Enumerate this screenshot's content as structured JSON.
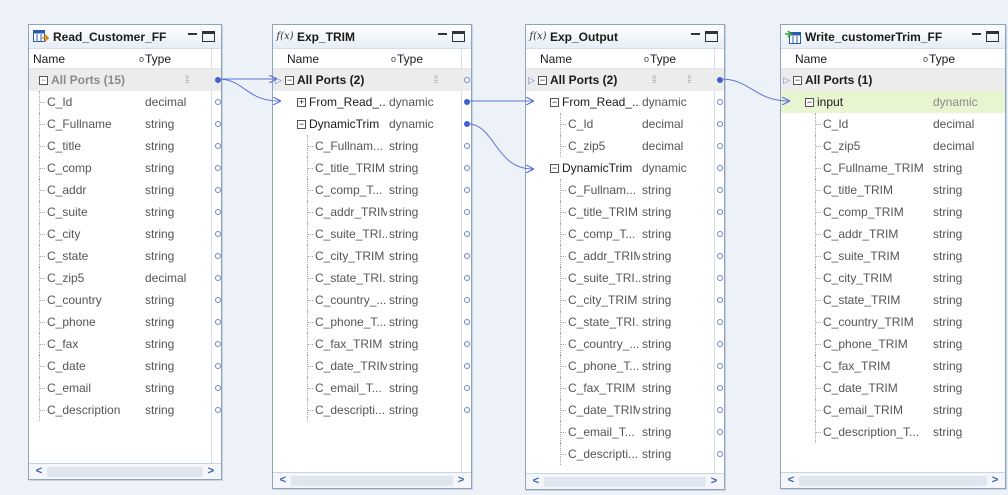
{
  "colors": {
    "link": "#5a73d6",
    "selected_row": "#e7f5d0",
    "all_ports_row": "#ececec"
  },
  "column_headers": {
    "name": "Name",
    "type": "Type"
  },
  "panels": [
    {
      "id": "read",
      "title": "Read_Customer_FF",
      "icon": "source-icon",
      "rows": [
        {
          "name": "All Ports (15)",
          "type": "",
          "kind": "allports",
          "expander": "minus",
          "disabled": true
        },
        {
          "name": "C_Id",
          "type": "decimal",
          "kind": "child"
        },
        {
          "name": "C_Fullname",
          "type": "string",
          "kind": "child"
        },
        {
          "name": "C_title",
          "type": "string",
          "kind": "child"
        },
        {
          "name": "C_comp",
          "type": "string",
          "kind": "child"
        },
        {
          "name": "C_addr",
          "type": "string",
          "kind": "child"
        },
        {
          "name": "C_suite",
          "type": "string",
          "kind": "child"
        },
        {
          "name": "C_city",
          "type": "string",
          "kind": "child"
        },
        {
          "name": "C_state",
          "type": "string",
          "kind": "child"
        },
        {
          "name": "C_zip5",
          "type": "decimal",
          "kind": "child"
        },
        {
          "name": "C_country",
          "type": "string",
          "kind": "child"
        },
        {
          "name": "C_phone",
          "type": "string",
          "kind": "child"
        },
        {
          "name": "C_fax",
          "type": "string",
          "kind": "child"
        },
        {
          "name": "C_date",
          "type": "string",
          "kind": "child"
        },
        {
          "name": "C_email",
          "type": "string",
          "kind": "child"
        },
        {
          "name": "C_description",
          "type": "string",
          "kind": "child"
        }
      ]
    },
    {
      "id": "trim",
      "title": "Exp_TRIM",
      "icon": "fx-icon",
      "rows": [
        {
          "name": "All Ports (2)",
          "type": "",
          "kind": "allports",
          "expander": "minus"
        },
        {
          "name": "From_Read_...",
          "type": "dynamic",
          "kind": "group",
          "expander": "plus"
        },
        {
          "name": "DynamicTrim",
          "type": "dynamic",
          "kind": "group",
          "expander": "minus"
        },
        {
          "name": "C_Fullnam...",
          "type": "string",
          "kind": "child"
        },
        {
          "name": "C_title_TRIM",
          "type": "string",
          "kind": "child"
        },
        {
          "name": "C_comp_T...",
          "type": "string",
          "kind": "child"
        },
        {
          "name": "C_addr_TRIM",
          "type": "string",
          "kind": "child"
        },
        {
          "name": "C_suite_TRI...",
          "type": "string",
          "kind": "child"
        },
        {
          "name": "C_city_TRIM",
          "type": "string",
          "kind": "child"
        },
        {
          "name": "C_state_TRI...",
          "type": "string",
          "kind": "child"
        },
        {
          "name": "C_country_...",
          "type": "string",
          "kind": "child"
        },
        {
          "name": "C_phone_T...",
          "type": "string",
          "kind": "child"
        },
        {
          "name": "C_fax_TRIM",
          "type": "string",
          "kind": "child"
        },
        {
          "name": "C_date_TRIM",
          "type": "string",
          "kind": "child"
        },
        {
          "name": "C_email_T...",
          "type": "string",
          "kind": "child"
        },
        {
          "name": "C_descripti...",
          "type": "string",
          "kind": "child"
        }
      ]
    },
    {
      "id": "output",
      "title": "Exp_Output",
      "icon": "fx-icon",
      "rows": [
        {
          "name": "All Ports (2)",
          "type": "",
          "kind": "allports",
          "expander": "minus"
        },
        {
          "name": "From_Read_...",
          "type": "dynamic",
          "kind": "group",
          "expander": "minus"
        },
        {
          "name": "C_Id",
          "type": "decimal",
          "kind": "child"
        },
        {
          "name": "C_zip5",
          "type": "decimal",
          "kind": "child"
        },
        {
          "name": "DynamicTrim",
          "type": "dynamic",
          "kind": "group",
          "expander": "minus"
        },
        {
          "name": "C_Fullnam...",
          "type": "string",
          "kind": "child"
        },
        {
          "name": "C_title_TRIM",
          "type": "string",
          "kind": "child"
        },
        {
          "name": "C_comp_T...",
          "type": "string",
          "kind": "child"
        },
        {
          "name": "C_addr_TRIM",
          "type": "string",
          "kind": "child"
        },
        {
          "name": "C_suite_TRI...",
          "type": "string",
          "kind": "child"
        },
        {
          "name": "C_city_TRIM",
          "type": "string",
          "kind": "child"
        },
        {
          "name": "C_state_TRI...",
          "type": "string",
          "kind": "child"
        },
        {
          "name": "C_country_...",
          "type": "string",
          "kind": "child"
        },
        {
          "name": "C_phone_T...",
          "type": "string",
          "kind": "child"
        },
        {
          "name": "C_fax_TRIM",
          "type": "string",
          "kind": "child"
        },
        {
          "name": "C_date_TRIM",
          "type": "string",
          "kind": "child"
        },
        {
          "name": "C_email_T...",
          "type": "string",
          "kind": "child"
        },
        {
          "name": "C_descripti...",
          "type": "string",
          "kind": "child"
        }
      ]
    },
    {
      "id": "write",
      "title": "Write_customerTrim_FF",
      "icon": "target-icon",
      "rows": [
        {
          "name": "All Ports (1)",
          "type": "",
          "kind": "allports",
          "expander": "minus"
        },
        {
          "name": "input",
          "type": "dynamic",
          "kind": "group",
          "expander": "minus",
          "selected": true
        },
        {
          "name": "C_Id",
          "type": "decimal",
          "kind": "child"
        },
        {
          "name": "C_zip5",
          "type": "decimal",
          "kind": "child"
        },
        {
          "name": "C_Fullname_TRIM",
          "type": "string",
          "kind": "child"
        },
        {
          "name": "C_title_TRIM",
          "type": "string",
          "kind": "child"
        },
        {
          "name": "C_comp_TRIM",
          "type": "string",
          "kind": "child"
        },
        {
          "name": "C_addr_TRIM",
          "type": "string",
          "kind": "child"
        },
        {
          "name": "C_suite_TRIM",
          "type": "string",
          "kind": "child"
        },
        {
          "name": "C_city_TRIM",
          "type": "string",
          "kind": "child"
        },
        {
          "name": "C_state_TRIM",
          "type": "string",
          "kind": "child"
        },
        {
          "name": "C_country_TRIM",
          "type": "string",
          "kind": "child"
        },
        {
          "name": "C_phone_TRIM",
          "type": "string",
          "kind": "child"
        },
        {
          "name": "C_fax_TRIM",
          "type": "string",
          "kind": "child"
        },
        {
          "name": "C_date_TRIM",
          "type": "string",
          "kind": "child"
        },
        {
          "name": "C_email_TRIM",
          "type": "string",
          "kind": "child"
        },
        {
          "name": "C_description_T...",
          "type": "string",
          "kind": "child"
        }
      ]
    }
  ]
}
